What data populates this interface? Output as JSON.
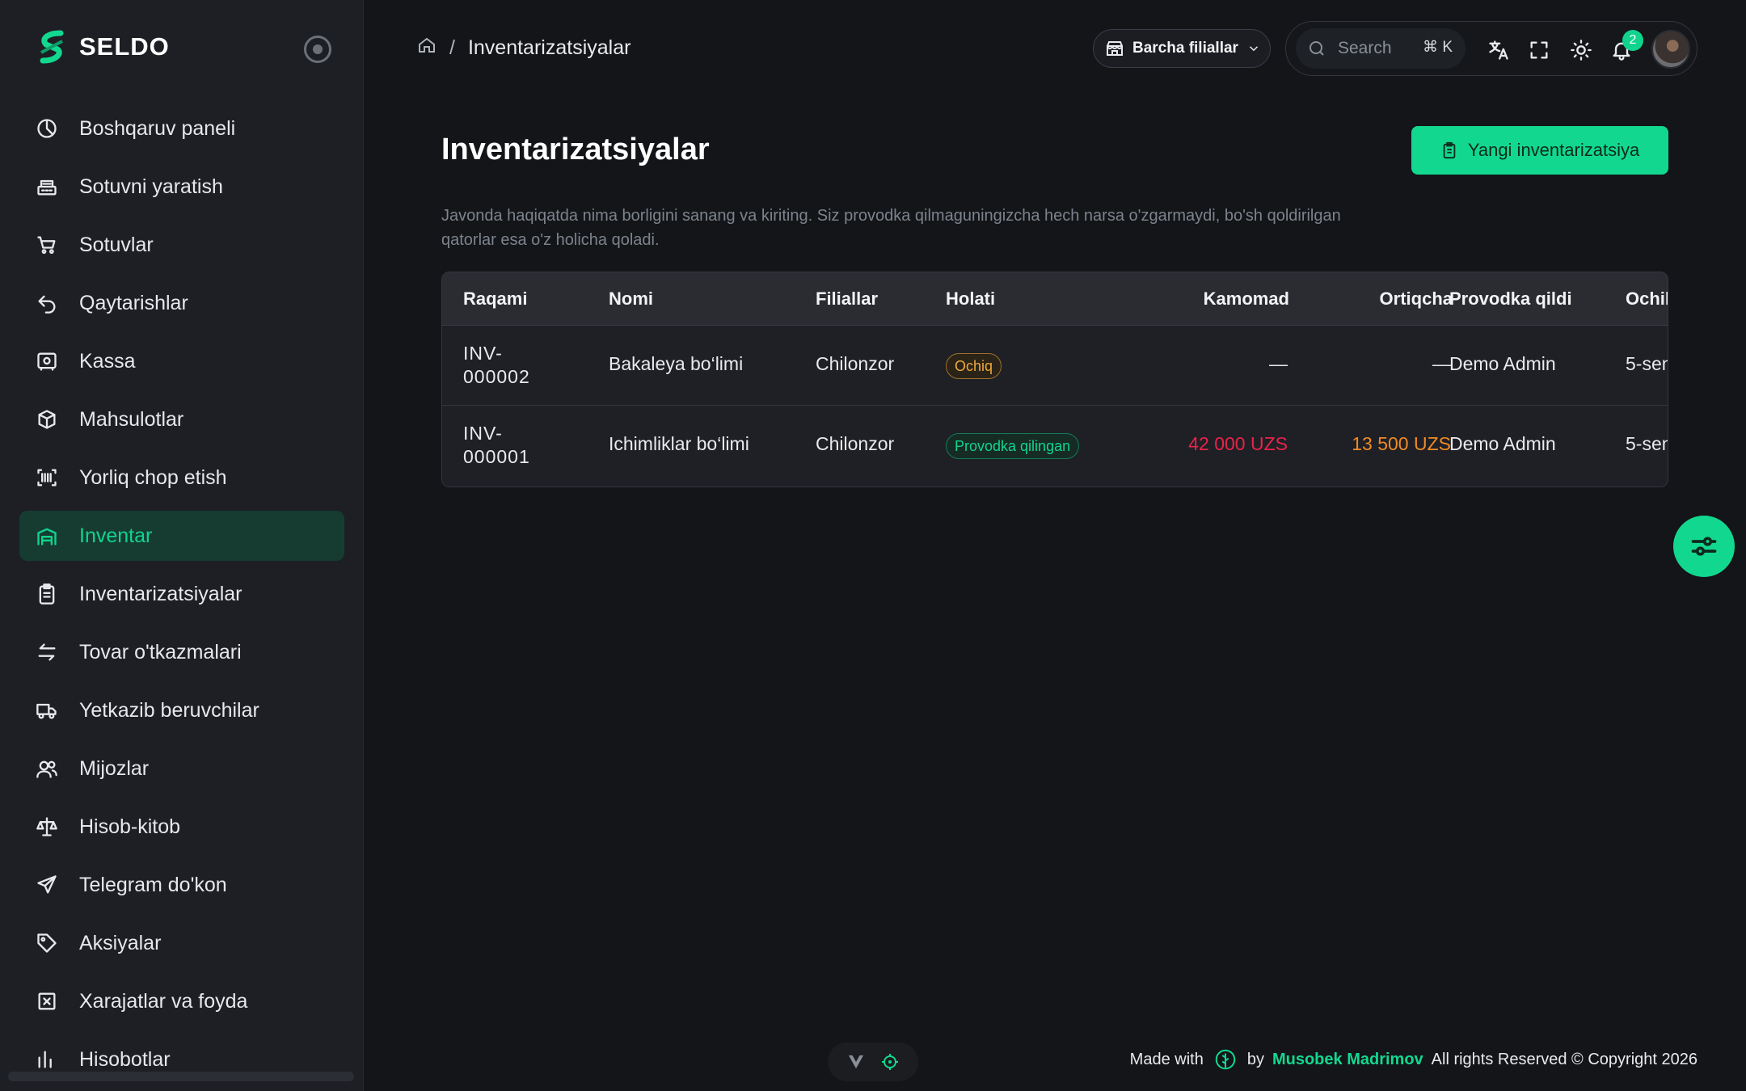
{
  "brand": {
    "name": "SELDO"
  },
  "sidebar": {
    "items": [
      {
        "label": "Boshqaruv paneli",
        "icon": "dashboard-icon"
      },
      {
        "label": "Sotuvni yaratish",
        "icon": "register-icon"
      },
      {
        "label": "Sotuvlar",
        "icon": "cart-icon"
      },
      {
        "label": "Qaytarishlar",
        "icon": "return-icon"
      },
      {
        "label": "Kassa",
        "icon": "safe-icon"
      },
      {
        "label": "Mahsulotlar",
        "icon": "box-icon"
      },
      {
        "label": "Yorliq chop etish",
        "icon": "barcode-icon"
      },
      {
        "label": "Inventar",
        "icon": "warehouse-icon",
        "active": true
      },
      {
        "label": "Inventarizatsiyalar",
        "icon": "clipboard-icon"
      },
      {
        "label": "Tovar o'tkazmalari",
        "icon": "transfer-icon"
      },
      {
        "label": "Yetkazib beruvchilar",
        "icon": "truck-icon"
      },
      {
        "label": "Mijozlar",
        "icon": "users-icon"
      },
      {
        "label": "Hisob-kitob",
        "icon": "scale-icon"
      },
      {
        "label": "Telegram do'kon",
        "icon": "send-icon"
      },
      {
        "label": "Aksiyalar",
        "icon": "tag-icon"
      },
      {
        "label": "Xarajatlar va foyda",
        "icon": "receipt-icon"
      },
      {
        "label": "Hisobotlar",
        "icon": "chart-icon"
      }
    ]
  },
  "header": {
    "breadcrumb_current": "Inventarizatsiyalar",
    "branch_label": "Barcha filiallar",
    "search_placeholder": "Search",
    "search_shortcut": "⌘ K",
    "notification_count": "2"
  },
  "main": {
    "title": "Inventarizatsiyalar",
    "new_button_label": "Yangi inventarizatsiya",
    "description": "Javonda haqiqatda nima borligini sanang va kiriting. Siz provodka qilmaguningizcha hech narsa o'zgarmaydi, bo'sh qoldirilgan qatorlar esa o'z holicha qoladi."
  },
  "table": {
    "columns": [
      "Raqami",
      "Nomi",
      "Filiallar",
      "Holati",
      "Kamomad",
      "Ortiqcha",
      "Provodka qildi",
      "Ochil"
    ],
    "rows": [
      {
        "number": "INV-000002",
        "name": "Bakaleya bo‘limi",
        "branch": "Chilonzor",
        "status": "Ochiq",
        "shortage": "—",
        "surplus": "—",
        "posted_by": "Demo Admin",
        "opened": "5-sen"
      },
      {
        "number": "INV-000001",
        "name": "Ichimliklar bo‘limi",
        "branch": "Chilonzor",
        "status": "Provodka qilingan",
        "shortage": "42 000 UZS",
        "surplus": "13 500 UZS",
        "posted_by": "Demo Admin",
        "opened": "5-sen"
      }
    ]
  },
  "footer": {
    "made_with": "Made with",
    "by": "by",
    "author": "Musobek Madrimov",
    "rights": "All rights Reserved © Copyright 2026"
  },
  "colors": {
    "accent": "#12d88f",
    "danger": "#e8234a",
    "warning": "#f08a24"
  }
}
